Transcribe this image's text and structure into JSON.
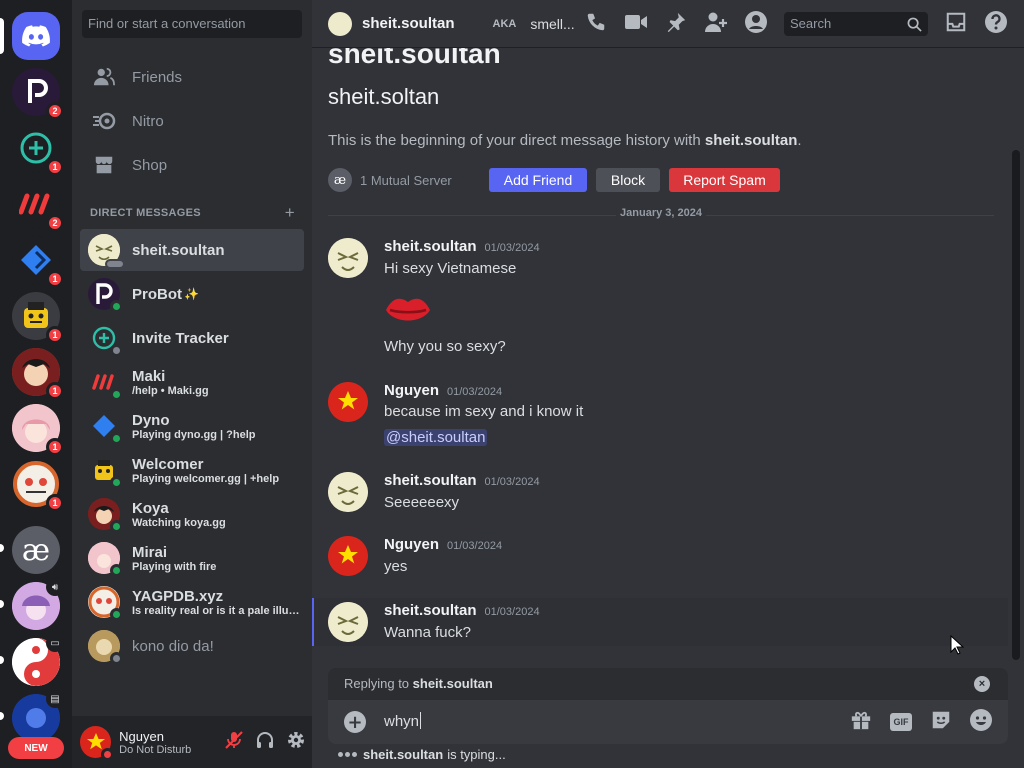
{
  "rail": {
    "servers": [
      {
        "name": "home",
        "badge": ""
      },
      {
        "name": "probot",
        "badge": "2"
      },
      {
        "name": "invite-tracker",
        "badge": "1"
      },
      {
        "name": "maki",
        "badge": "2"
      },
      {
        "name": "dyno",
        "badge": "1"
      },
      {
        "name": "welcomer",
        "badge": "1"
      },
      {
        "name": "koya",
        "badge": "1"
      },
      {
        "name": "mirai",
        "badge": "1"
      },
      {
        "name": "yagpdb",
        "badge": "1"
      },
      {
        "name": "ae-server",
        "badge": "",
        "letter": "æ"
      },
      {
        "name": "anime-server",
        "badge": ""
      },
      {
        "name": "yin-yang-server",
        "badge": ""
      },
      {
        "name": "blue-server",
        "badge": ""
      }
    ],
    "new_label": "NEW"
  },
  "sidebar": {
    "search_placeholder": "Find or start a conversation",
    "nav": [
      {
        "label": "Friends",
        "icon": "friends-icon"
      },
      {
        "label": "Nitro",
        "icon": "nitro-icon"
      },
      {
        "label": "Shop",
        "icon": "shop-icon"
      }
    ],
    "dm_header": "DIRECT MESSAGES",
    "dm_plus": "+",
    "dms": [
      {
        "name": "sheit.soultan",
        "sub": "",
        "status": "off"
      },
      {
        "name": "ProBot",
        "sub": "",
        "status": "on",
        "sparkle": "✨"
      },
      {
        "name": "Invite Tracker",
        "sub": "",
        "status": "off"
      },
      {
        "name": "Maki",
        "sub": "/help • Maki.gg",
        "status": "on"
      },
      {
        "name": "Dyno",
        "sub": "Playing dyno.gg | ?help",
        "status": "on"
      },
      {
        "name": "Welcomer",
        "sub": "Playing welcomer.gg | +help",
        "status": "on"
      },
      {
        "name": "Koya",
        "sub": "Watching koya.gg",
        "status": "on"
      },
      {
        "name": "Mirai",
        "sub": "Playing with fire",
        "status": "on"
      },
      {
        "name": "YAGPDB.xyz",
        "sub": "Is reality real or is it a pale illusion",
        "status": "on"
      },
      {
        "name": "kono dio da!",
        "sub": "",
        "status": "off"
      }
    ],
    "user": {
      "name": "Nguyen",
      "status": "Do Not Disturb"
    }
  },
  "topbar": {
    "title": "sheit.soultan",
    "aka_label": "AKA",
    "aka_name": "smell...",
    "search_placeholder": "Search"
  },
  "intro": {
    "display_name": "sheit.soultan",
    "username": "sheit.soltan",
    "text_prefix": "This is the beginning of your direct message history with ",
    "text_name": "sheit.soultan",
    "text_suffix": ".",
    "mutual_letter": "æ",
    "mutual": "1 Mutual Server",
    "add_friend": "Add Friend",
    "block": "Block",
    "report_spam": "Report Spam"
  },
  "date_divider": "January 3, 2024",
  "messages": [
    {
      "author": "sheit.soultan",
      "time": "01/03/2024",
      "lines": [
        "Hi sexy Vietnamese",
        "Why you so sexy?"
      ]
    },
    {
      "author": "Nguyen",
      "time": "01/03/2024",
      "lines": [
        "because im sexy and i know it",
        "@sheit.soultan"
      ]
    },
    {
      "author": "sheit.soultan",
      "time": "01/03/2024",
      "lines": [
        "Seeeeeexy"
      ]
    },
    {
      "author": "Nguyen",
      "time": "01/03/2024",
      "lines": [
        "yes"
      ]
    },
    {
      "author": "sheit.soultan",
      "time": "01/03/2024",
      "lines": [
        "Wanna fuck?"
      ]
    }
  ],
  "reply": {
    "prefix": "Replying to ",
    "name": "sheit.soultan"
  },
  "composer": {
    "value": "whyn",
    "gif_label": "GIF"
  },
  "typing": {
    "name": "sheit.soultan",
    "text": "is typing..."
  },
  "colors": {
    "accent": "#5865f2",
    "danger": "#da373c",
    "online": "#23a55a",
    "dnd": "#f23f43",
    "block": "#4e5058"
  }
}
